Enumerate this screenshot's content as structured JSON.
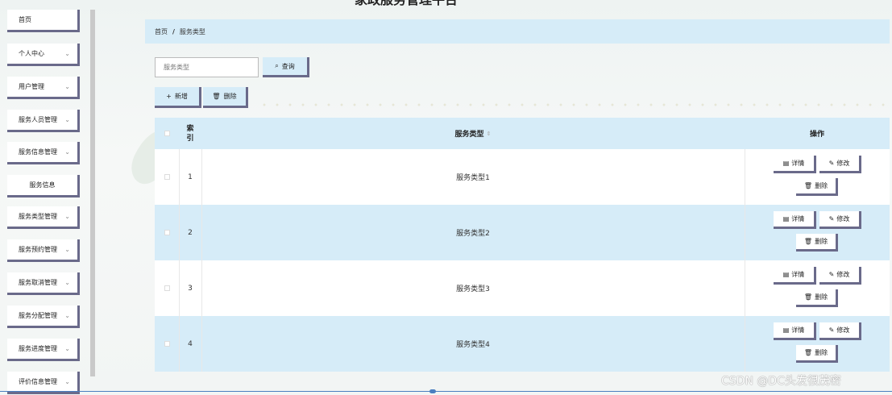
{
  "header": {
    "title": "家政服务管理平台"
  },
  "sidebar": {
    "items": [
      {
        "label": "首页",
        "has_chevron": false
      },
      {
        "label": "个人中心",
        "has_chevron": true
      },
      {
        "label": "用户管理",
        "has_chevron": true
      },
      {
        "label": "服务人员管理",
        "has_chevron": true
      },
      {
        "label": "服务信息管理",
        "has_chevron": true
      },
      {
        "label": "服务信息",
        "has_chevron": false,
        "sub": true
      },
      {
        "label": "服务类型管理",
        "has_chevron": true
      },
      {
        "label": "服务预约管理",
        "has_chevron": true
      },
      {
        "label": "服务取消管理",
        "has_chevron": true
      },
      {
        "label": "服务分配管理",
        "has_chevron": true
      },
      {
        "label": "服务进度管理",
        "has_chevron": true
      },
      {
        "label": "评价信息管理",
        "has_chevron": true
      }
    ]
  },
  "breadcrumb": {
    "home": "首页",
    "separator": "/",
    "current": "服务类型"
  },
  "search": {
    "placeholder": "服务类型",
    "button_label": "查询",
    "button_icon": "search-icon"
  },
  "toolbar": {
    "add_label": "新增",
    "add_icon": "plus-icon",
    "delete_label": "删除",
    "delete_icon": "trash-icon"
  },
  "table": {
    "columns": {
      "index": "索\n引",
      "type": "服务类型",
      "actions": "操作"
    },
    "rows": [
      {
        "index": "1",
        "type": "服务类型1"
      },
      {
        "index": "2",
        "type": "服务类型2"
      },
      {
        "index": "3",
        "type": "服务类型3"
      },
      {
        "index": "4",
        "type": "服务类型4"
      }
    ],
    "actions": {
      "detail": "详情",
      "edit": "修改",
      "delete": "删除"
    }
  },
  "watermark": "CSDN @DC头发很茂密",
  "colors": {
    "accent": "#d6ecf8",
    "border": "#6a6a8a"
  }
}
